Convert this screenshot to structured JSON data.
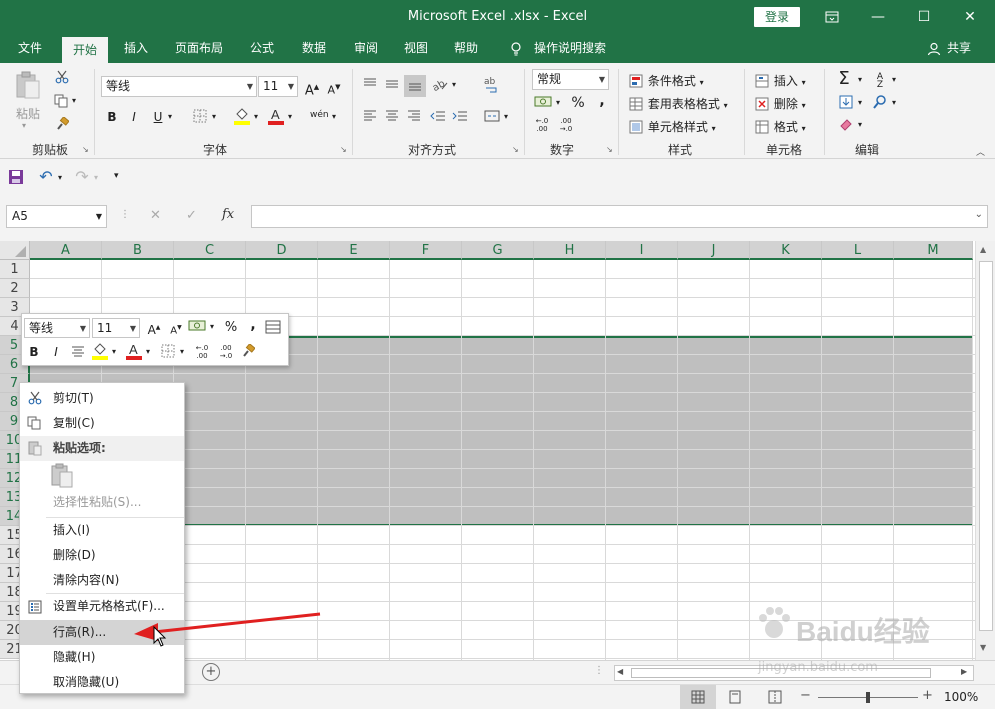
{
  "window": {
    "title": "Microsoft Excel .xlsx  -  Excel",
    "login_label": "登录",
    "ribbon_display_icon": "ribbon-display-icon",
    "minimize_glyph": "—",
    "maximize_glyph": "☐",
    "close_glyph": "✕"
  },
  "tabs": [
    "文件",
    "开始",
    "插入",
    "页面布局",
    "公式",
    "数据",
    "审阅",
    "视图",
    "帮助"
  ],
  "active_tab": "开始",
  "tell_me": "操作说明搜索",
  "share": "共享",
  "ribbon": {
    "clipboard": {
      "label": "剪贴板",
      "paste": "粘贴"
    },
    "font": {
      "label": "字体",
      "font_name": "等线",
      "font_size": "11",
      "bold": "B",
      "italic": "I",
      "underline": "U"
    },
    "alignment": {
      "label": "对齐方式"
    },
    "number": {
      "label": "数字",
      "format": "常规",
      "percent": "%",
      "comma": ",",
      "inc_decimal": ".00 →.0",
      "dec_decimal": ".00 →.0"
    },
    "styles": {
      "label": "样式",
      "conditional": "条件格式",
      "table": "套用表格格式",
      "cell_styles": "单元格样式"
    },
    "cells": {
      "label": "单元格",
      "insert": "插入",
      "delete": "删除",
      "format": "格式"
    },
    "editing": {
      "label": "编辑"
    }
  },
  "formula_bar": {
    "name_box": "A5",
    "cancel": "✕",
    "enter": "✓",
    "fx": "fx",
    "value": ""
  },
  "columns": [
    "A",
    "B",
    "C",
    "D",
    "E",
    "F",
    "G",
    "H",
    "I",
    "J",
    "K",
    "L",
    "M"
  ],
  "rows": [
    "1",
    "2",
    "3",
    "4",
    "5",
    "6",
    "7",
    "8",
    "9",
    "10",
    "11",
    "12",
    "13",
    "14",
    "15",
    "16",
    "17",
    "18",
    "19",
    "20",
    "21"
  ],
  "selected_rows": [
    "5",
    "6",
    "7",
    "8",
    "9",
    "10",
    "11",
    "12",
    "13",
    "14"
  ],
  "mini_toolbar": {
    "font_name": "等线",
    "font_size": "11",
    "bold": "B",
    "italic": "I",
    "percent": "%",
    "comma": ","
  },
  "context_menu": {
    "items": [
      {
        "label": "剪切(T)",
        "icon": "scissors-icon",
        "state": "normal"
      },
      {
        "label": "复制(C)",
        "icon": "copy-icon",
        "state": "normal"
      },
      {
        "label": "粘贴选项:",
        "icon": "paste-icon",
        "state": "header"
      },
      {
        "label": "",
        "icon": "paste-clipboard-icon",
        "state": "paste-row"
      },
      {
        "label": "选择性粘贴(S)...",
        "icon": "",
        "state": "disabled"
      },
      {
        "label": "插入(I)",
        "icon": "",
        "state": "normal"
      },
      {
        "label": "删除(D)",
        "icon": "",
        "state": "normal"
      },
      {
        "label": "清除内容(N)",
        "icon": "",
        "state": "normal"
      },
      {
        "label": "设置单元格格式(F)...",
        "icon": "format-cells-icon",
        "state": "normal"
      },
      {
        "label": "行高(R)...",
        "icon": "",
        "state": "hover"
      },
      {
        "label": "隐藏(H)",
        "icon": "",
        "state": "normal"
      },
      {
        "label": "取消隐藏(U)",
        "icon": "",
        "state": "normal"
      }
    ]
  },
  "status_bar": {
    "zoom": "100%",
    "zoom_fraction": 0.5
  },
  "watermark": {
    "brand": "Baidu经验",
    "url": "jingyan.baidu.com"
  },
  "colors": {
    "excel_green": "#217346",
    "selection": "#bfbfbf",
    "arrow_red": "#e02020"
  }
}
